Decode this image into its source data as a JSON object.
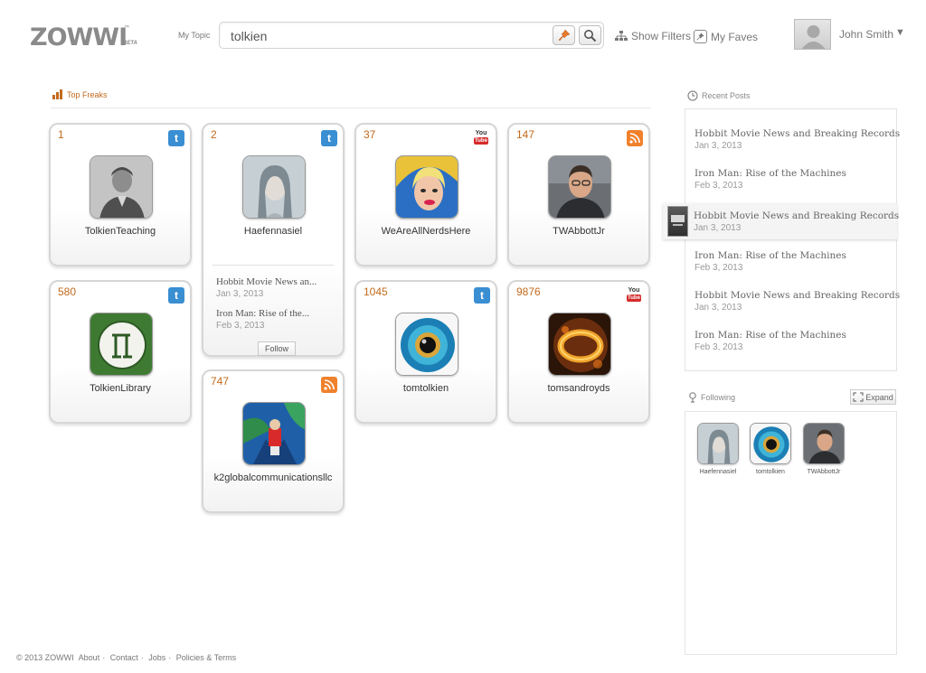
{
  "header": {
    "logo": "ZOWWI",
    "logo_tm": "™",
    "logo_beta": "BETA",
    "topic_label": "My Topic",
    "search_value": "tolkien",
    "show_filters": "Show Filters",
    "my_faves": "My Faves",
    "user_name": "John Smith",
    "user_caret": "▼"
  },
  "top_freaks": {
    "title": "Top Freaks",
    "cards": [
      {
        "rank": "1",
        "name": "TolkienTeaching",
        "source": "twitter-icon"
      },
      {
        "rank": "2",
        "name": "Haefennasiel",
        "source": "twitter-icon",
        "posts": [
          {
            "title": "Hobbit Movie News an...",
            "date": "Jan 3, 2013"
          },
          {
            "title": "Iron Man: Rise of the...",
            "date": "Feb 3, 2013"
          }
        ],
        "follow_label": "Follow"
      },
      {
        "rank": "37",
        "name": "WeAreAllNerdsHere",
        "source": "youtube-icon",
        "yt_top": "You",
        "yt_bot": "Tube"
      },
      {
        "rank": "147",
        "name": "TWAbbottJr",
        "source": "rss-icon"
      },
      {
        "rank": "580",
        "name": "TolkienLibrary",
        "source": "twitter-icon"
      },
      {
        "rank": "1045",
        "name": "tomtolkien",
        "source": "twitter-icon"
      },
      {
        "rank": "9876",
        "name": "tomsandroyds",
        "source": "youtube-icon",
        "yt_top": "You",
        "yt_bot": "Tube"
      },
      {
        "rank": "747",
        "name": "k2globalcommunicationsllc",
        "source": "rss-icon"
      }
    ]
  },
  "recent_posts": {
    "title": "Recent Posts",
    "items": [
      {
        "title": "Hobbit Movie News and Breaking Records",
        "date": "Jan 3, 2013"
      },
      {
        "title": "Iron Man: Rise of the Machines",
        "date": "Feb 3, 2013"
      },
      {
        "title": "Hobbit Movie News and Breaking Records",
        "date": "Jan 3, 2013"
      },
      {
        "title": "Iron Man: Rise of the Machines",
        "date": "Feb 3, 2013"
      },
      {
        "title": "Hobbit Movie News and Breaking Records",
        "date": "Jan 3, 2013"
      },
      {
        "title": "Iron Man: Rise of the Machines",
        "date": "Feb 3, 2013"
      }
    ]
  },
  "following": {
    "title": "Following",
    "expand_label": "Expand",
    "items": [
      {
        "name": "Haefennasiel"
      },
      {
        "name": "tomtolkien"
      },
      {
        "name": "TWAbbottJr"
      }
    ]
  },
  "footer": {
    "copyright": "© 2013 ZOWWI",
    "links": [
      "About",
      "Contact",
      "Jobs",
      "Policies & Terms"
    ],
    "separator": "·"
  },
  "colors": {
    "accent_orange": "#c26a1b",
    "twitter_blue": "#3a8ed2",
    "rss_orange": "#f0812c",
    "youtube_red": "#d42b2b"
  }
}
